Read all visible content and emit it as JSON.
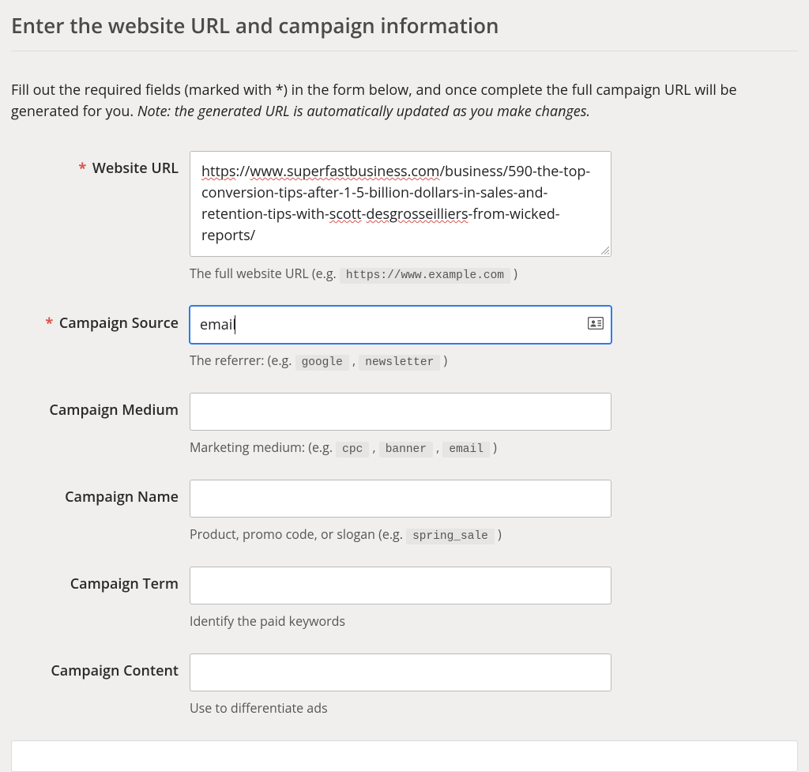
{
  "heading": "Enter the website URL and campaign information",
  "intro_plain": "Fill out the required fields (marked with *) in the form below, and once complete the full campaign URL will be generated for you. ",
  "intro_note": "Note: the generated URL is automatically updated as you make changes.",
  "required_marker": "*",
  "fields": {
    "website_url": {
      "label": "Website URL",
      "required": true,
      "value": "https://www.superfastbusiness.com/business/590-the-top-conversion-tips-after-1-5-billion-dollars-in-sales-and-retention-tips-with-scott-desgrosseilliers-from-wicked-reports/",
      "value_parts": {
        "p1": "https",
        "p2": "://",
        "p3": "www.superfastbusiness.com",
        "p4": "/business/590-the-top-conversion-tips-after-1-5-billion-dollars-in-sales-and-retention-tips-with-",
        "p5": "scott",
        "p6": "-",
        "p7": "desgrosseilliers",
        "p8": "-from-wicked-reports/"
      },
      "helper_pre": "The full website URL (e.g. ",
      "helper_code1": "https://www.example.com",
      "helper_post": " )"
    },
    "campaign_source": {
      "label": "Campaign Source",
      "required": true,
      "value": "email",
      "helper_pre": "The referrer: (e.g. ",
      "helper_code1": "google",
      "helper_sep": " , ",
      "helper_code2": "newsletter",
      "helper_post": " )"
    },
    "campaign_medium": {
      "label": "Campaign Medium",
      "required": false,
      "value": "",
      "helper_pre": "Marketing medium: (e.g. ",
      "helper_code1": "cpc",
      "helper_sep1": " , ",
      "helper_code2": "banner",
      "helper_sep2": " , ",
      "helper_code3": "email",
      "helper_post": " )"
    },
    "campaign_name": {
      "label": "Campaign Name",
      "required": false,
      "value": "",
      "helper_pre": "Product, promo code, or slogan (e.g. ",
      "helper_code1": "spring_sale",
      "helper_post": " )"
    },
    "campaign_term": {
      "label": "Campaign Term",
      "required": false,
      "value": "",
      "helper": "Identify the paid keywords"
    },
    "campaign_content": {
      "label": "Campaign Content",
      "required": false,
      "value": "",
      "helper": "Use to differentiate ads"
    }
  }
}
